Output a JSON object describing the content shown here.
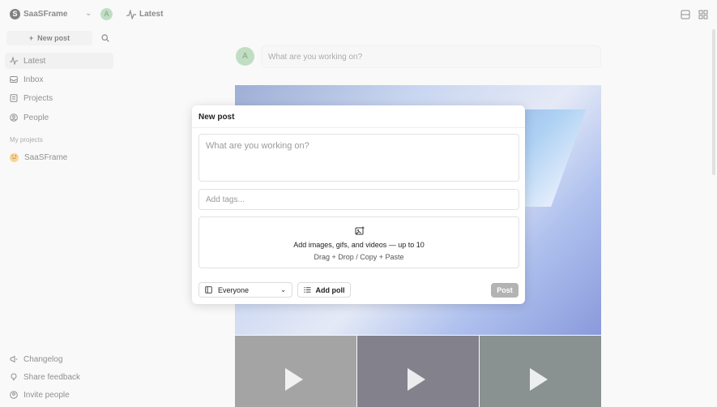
{
  "workspace": {
    "logo": "S",
    "name": "SaaSFrame",
    "avatar": "A"
  },
  "sidebar": {
    "new_post_label": "New post",
    "items": [
      {
        "label": "Latest",
        "icon": "activity-icon",
        "active": true
      },
      {
        "label": "Inbox",
        "icon": "inbox-icon"
      },
      {
        "label": "Projects",
        "icon": "projects-icon"
      },
      {
        "label": "People",
        "icon": "people-icon"
      }
    ],
    "section_label": "My projects",
    "project": {
      "label": "SaaSFrame",
      "emoji": "🤩"
    },
    "footer": [
      {
        "label": "Changelog"
      },
      {
        "label": "Share feedback"
      },
      {
        "label": "Invite people"
      }
    ]
  },
  "main": {
    "title": "Latest",
    "composer_avatar": "A",
    "composer_placeholder": "What are you working on?"
  },
  "modal": {
    "title": "New post",
    "body_placeholder": "What are you working on?",
    "tags_placeholder": "Add tags...",
    "upload_title": "Add images, gifs, and videos — up to 10",
    "upload_hint": "Drag + Drop / Copy + Paste",
    "audience": "Everyone",
    "poll_label": "Add poll",
    "post_label": "Post"
  },
  "colors": {
    "accent_avatar": "#8fc491",
    "post_disabled": "#b3b3b3"
  }
}
